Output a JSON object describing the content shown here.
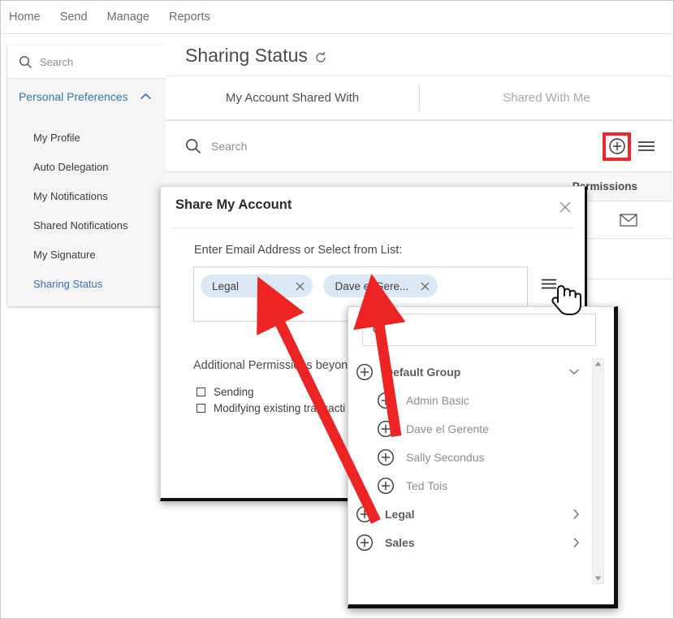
{
  "topnav": {
    "items": [
      {
        "label": "Home"
      },
      {
        "label": "Send"
      },
      {
        "label": "Manage"
      },
      {
        "label": "Reports"
      }
    ]
  },
  "sidebar": {
    "search_placeholder": "Search",
    "search_icon": "search-icon",
    "section": {
      "label": "Personal Preferences",
      "chevron": "chevron-up-icon"
    },
    "items": [
      {
        "label": "My Profile",
        "active": false
      },
      {
        "label": "Auto Delegation",
        "active": false
      },
      {
        "label": "My Notifications",
        "active": false
      },
      {
        "label": "Shared Notifications",
        "active": false
      },
      {
        "label": "My Signature",
        "active": false
      },
      {
        "label": "Sharing Status",
        "active": true
      }
    ]
  },
  "main": {
    "page_title": "Sharing Status",
    "refresh_icon": "refresh-icon",
    "tabs": [
      {
        "label": "My Account Shared With",
        "active": true
      },
      {
        "label": "Shared With Me",
        "active": false
      }
    ],
    "search_placeholder": "Search",
    "search_icon": "search-icon",
    "add_button_icon": "plus-circle-icon",
    "menu_button_icon": "hamburger-icon",
    "column_header": "Permissions",
    "row_icon": "envelope-icon"
  },
  "dialog": {
    "title": "Share My Account",
    "close_icon": "close-icon",
    "field_label": "Enter Email Address or Select from List:",
    "chips": [
      {
        "label": "Legal",
        "remove_icon": "close-icon"
      },
      {
        "label": "Dave el Gere...",
        "remove_icon": "close-icon"
      }
    ],
    "list_button_icon": "hamburger-icon",
    "permissions_label": "Additional Permissions beyond",
    "permissions": [
      {
        "label": "Sending",
        "checked": false
      },
      {
        "label": "Modifying existing transacti",
        "checked": false
      }
    ]
  },
  "dropdown": {
    "search_icon": "search-icon",
    "search_value": "",
    "scroll_up_icon": "triangle-up-icon",
    "scroll_down_icon": "triangle-down-icon",
    "items": [
      {
        "label": "Default Group",
        "type": "group",
        "indicator": "chevron-down-icon",
        "add_icon": "plus-circle-icon"
      },
      {
        "label": "Admin Basic",
        "type": "user",
        "indicator": "",
        "add_icon": "plus-circle-icon"
      },
      {
        "label": "Dave el Gerente",
        "type": "user",
        "indicator": "",
        "add_icon": "plus-circle-icon"
      },
      {
        "label": "Sally Secondus",
        "type": "user",
        "indicator": "",
        "add_icon": "plus-circle-icon"
      },
      {
        "label": "Ted Tois",
        "type": "user",
        "indicator": "",
        "add_icon": "plus-circle-icon"
      },
      {
        "label": "Legal",
        "type": "group",
        "indicator": "chevron-right-icon",
        "add_icon": "plus-circle-icon"
      },
      {
        "label": "Sales",
        "type": "group",
        "indicator": "chevron-right-icon",
        "add_icon": "plus-circle-icon"
      }
    ]
  },
  "annotations": {
    "arrow_color": "#ee2323",
    "highlight_color": "#f0262c",
    "cursor_icon": "pointing-hand-cursor"
  },
  "colors": {
    "link_blue": "#3574b5",
    "chip_blue": "#dbe9f7",
    "text_dark": "#3b3b3b",
    "text_muted": "#8e8e8e"
  }
}
